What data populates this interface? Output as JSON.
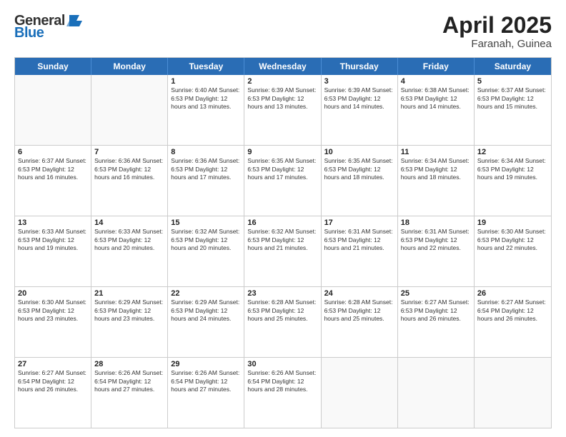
{
  "header": {
    "logo_general": "General",
    "logo_blue": "Blue",
    "month_title": "April 2025",
    "location": "Faranah, Guinea"
  },
  "days_of_week": [
    "Sunday",
    "Monday",
    "Tuesday",
    "Wednesday",
    "Thursday",
    "Friday",
    "Saturday"
  ],
  "weeks": [
    [
      {
        "day": "",
        "info": ""
      },
      {
        "day": "",
        "info": ""
      },
      {
        "day": "1",
        "info": "Sunrise: 6:40 AM\nSunset: 6:53 PM\nDaylight: 12 hours and 13 minutes."
      },
      {
        "day": "2",
        "info": "Sunrise: 6:39 AM\nSunset: 6:53 PM\nDaylight: 12 hours and 13 minutes."
      },
      {
        "day": "3",
        "info": "Sunrise: 6:39 AM\nSunset: 6:53 PM\nDaylight: 12 hours and 14 minutes."
      },
      {
        "day": "4",
        "info": "Sunrise: 6:38 AM\nSunset: 6:53 PM\nDaylight: 12 hours and 14 minutes."
      },
      {
        "day": "5",
        "info": "Sunrise: 6:37 AM\nSunset: 6:53 PM\nDaylight: 12 hours and 15 minutes."
      }
    ],
    [
      {
        "day": "6",
        "info": "Sunrise: 6:37 AM\nSunset: 6:53 PM\nDaylight: 12 hours and 16 minutes."
      },
      {
        "day": "7",
        "info": "Sunrise: 6:36 AM\nSunset: 6:53 PM\nDaylight: 12 hours and 16 minutes."
      },
      {
        "day": "8",
        "info": "Sunrise: 6:36 AM\nSunset: 6:53 PM\nDaylight: 12 hours and 17 minutes."
      },
      {
        "day": "9",
        "info": "Sunrise: 6:35 AM\nSunset: 6:53 PM\nDaylight: 12 hours and 17 minutes."
      },
      {
        "day": "10",
        "info": "Sunrise: 6:35 AM\nSunset: 6:53 PM\nDaylight: 12 hours and 18 minutes."
      },
      {
        "day": "11",
        "info": "Sunrise: 6:34 AM\nSunset: 6:53 PM\nDaylight: 12 hours and 18 minutes."
      },
      {
        "day": "12",
        "info": "Sunrise: 6:34 AM\nSunset: 6:53 PM\nDaylight: 12 hours and 19 minutes."
      }
    ],
    [
      {
        "day": "13",
        "info": "Sunrise: 6:33 AM\nSunset: 6:53 PM\nDaylight: 12 hours and 19 minutes."
      },
      {
        "day": "14",
        "info": "Sunrise: 6:33 AM\nSunset: 6:53 PM\nDaylight: 12 hours and 20 minutes."
      },
      {
        "day": "15",
        "info": "Sunrise: 6:32 AM\nSunset: 6:53 PM\nDaylight: 12 hours and 20 minutes."
      },
      {
        "day": "16",
        "info": "Sunrise: 6:32 AM\nSunset: 6:53 PM\nDaylight: 12 hours and 21 minutes."
      },
      {
        "day": "17",
        "info": "Sunrise: 6:31 AM\nSunset: 6:53 PM\nDaylight: 12 hours and 21 minutes."
      },
      {
        "day": "18",
        "info": "Sunrise: 6:31 AM\nSunset: 6:53 PM\nDaylight: 12 hours and 22 minutes."
      },
      {
        "day": "19",
        "info": "Sunrise: 6:30 AM\nSunset: 6:53 PM\nDaylight: 12 hours and 22 minutes."
      }
    ],
    [
      {
        "day": "20",
        "info": "Sunrise: 6:30 AM\nSunset: 6:53 PM\nDaylight: 12 hours and 23 minutes."
      },
      {
        "day": "21",
        "info": "Sunrise: 6:29 AM\nSunset: 6:53 PM\nDaylight: 12 hours and 23 minutes."
      },
      {
        "day": "22",
        "info": "Sunrise: 6:29 AM\nSunset: 6:53 PM\nDaylight: 12 hours and 24 minutes."
      },
      {
        "day": "23",
        "info": "Sunrise: 6:28 AM\nSunset: 6:53 PM\nDaylight: 12 hours and 25 minutes."
      },
      {
        "day": "24",
        "info": "Sunrise: 6:28 AM\nSunset: 6:53 PM\nDaylight: 12 hours and 25 minutes."
      },
      {
        "day": "25",
        "info": "Sunrise: 6:27 AM\nSunset: 6:53 PM\nDaylight: 12 hours and 26 minutes."
      },
      {
        "day": "26",
        "info": "Sunrise: 6:27 AM\nSunset: 6:54 PM\nDaylight: 12 hours and 26 minutes."
      }
    ],
    [
      {
        "day": "27",
        "info": "Sunrise: 6:27 AM\nSunset: 6:54 PM\nDaylight: 12 hours and 26 minutes."
      },
      {
        "day": "28",
        "info": "Sunrise: 6:26 AM\nSunset: 6:54 PM\nDaylight: 12 hours and 27 minutes."
      },
      {
        "day": "29",
        "info": "Sunrise: 6:26 AM\nSunset: 6:54 PM\nDaylight: 12 hours and 27 minutes."
      },
      {
        "day": "30",
        "info": "Sunrise: 6:26 AM\nSunset: 6:54 PM\nDaylight: 12 hours and 28 minutes."
      },
      {
        "day": "",
        "info": ""
      },
      {
        "day": "",
        "info": ""
      },
      {
        "day": "",
        "info": ""
      }
    ]
  ]
}
